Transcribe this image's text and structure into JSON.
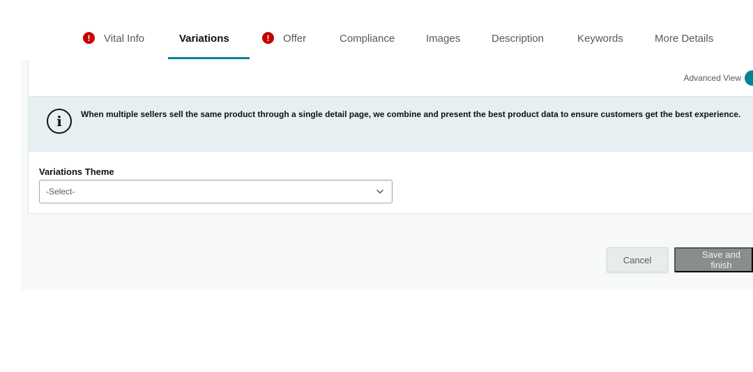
{
  "tabs": [
    {
      "label": "Vital Info",
      "alert": true,
      "active": false
    },
    {
      "label": "Variations",
      "alert": false,
      "active": true
    },
    {
      "label": "Offer",
      "alert": true,
      "active": false
    },
    {
      "label": "Compliance",
      "alert": false,
      "active": false
    },
    {
      "label": "Images",
      "alert": false,
      "active": false
    },
    {
      "label": "Description",
      "alert": false,
      "active": false
    },
    {
      "label": "Keywords",
      "alert": false,
      "active": false
    },
    {
      "label": "More Details",
      "alert": false,
      "active": false
    }
  ],
  "alert_glyph": "!",
  "advanced_view": {
    "label": "Advanced View",
    "enabled": true
  },
  "info": {
    "icon": "info-icon",
    "glyph": "i",
    "text": "When multiple sellers sell the same product through a single detail page, we combine and present the best product data to ensure customers get the best experience."
  },
  "variations_theme": {
    "label": "Variations Theme",
    "selected": "-Select-"
  },
  "actions": {
    "cancel_label": "Cancel",
    "save_label": "Save and finish"
  },
  "colors": {
    "accent": "#008296",
    "alert": "#c40000",
    "info_bg": "#e6f0f3"
  }
}
